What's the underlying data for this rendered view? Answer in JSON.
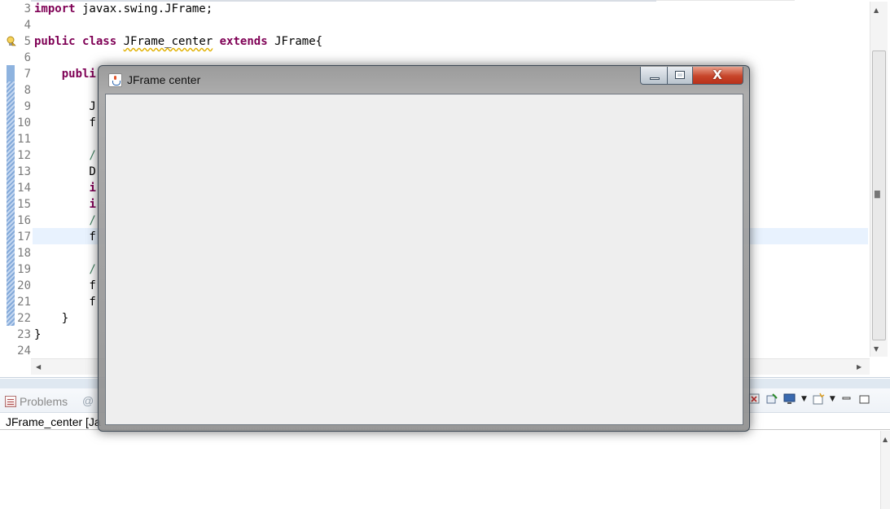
{
  "editor": {
    "lines": [
      {
        "num": "3",
        "segments": [
          {
            "t": "import",
            "c": "kw"
          },
          {
            "t": " javax.swing.JFrame;",
            "c": ""
          }
        ]
      },
      {
        "num": "4",
        "segments": []
      },
      {
        "num": "5",
        "segments": [
          {
            "t": "public",
            "c": "kw"
          },
          {
            "t": " ",
            "c": ""
          },
          {
            "t": "class",
            "c": "kw"
          },
          {
            "t": " ",
            "c": ""
          },
          {
            "t": "JFrame_center",
            "c": "squiggle"
          },
          {
            "t": " ",
            "c": ""
          },
          {
            "t": "extends",
            "c": "kw"
          },
          {
            "t": " JFrame{",
            "c": ""
          }
        ]
      },
      {
        "num": "6",
        "segments": []
      },
      {
        "num": "7",
        "segments": [
          {
            "t": "    ",
            "c": ""
          },
          {
            "t": "publi",
            "c": "kw"
          }
        ]
      },
      {
        "num": "8",
        "segments": []
      },
      {
        "num": "9",
        "segments": [
          {
            "t": "        J",
            "c": ""
          }
        ]
      },
      {
        "num": "10",
        "segments": [
          {
            "t": "        f",
            "c": ""
          }
        ]
      },
      {
        "num": "11",
        "segments": []
      },
      {
        "num": "12",
        "segments": [
          {
            "t": "        /",
            "c": "cmt"
          }
        ]
      },
      {
        "num": "13",
        "segments": [
          {
            "t": "        D",
            "c": ""
          }
        ]
      },
      {
        "num": "14",
        "segments": [
          {
            "t": "        ",
            "c": ""
          },
          {
            "t": "i",
            "c": "kw"
          }
        ]
      },
      {
        "num": "15",
        "segments": [
          {
            "t": "        ",
            "c": ""
          },
          {
            "t": "i",
            "c": "kw"
          }
        ]
      },
      {
        "num": "16",
        "segments": [
          {
            "t": "        /",
            "c": "cmt"
          }
        ]
      },
      {
        "num": "17",
        "segments": [
          {
            "t": "        f",
            "c": ""
          }
        ]
      },
      {
        "num": "18",
        "segments": []
      },
      {
        "num": "19",
        "segments": [
          {
            "t": "        /",
            "c": "cmt"
          }
        ]
      },
      {
        "num": "20",
        "segments": [
          {
            "t": "        f",
            "c": ""
          }
        ]
      },
      {
        "num": "21",
        "segments": [
          {
            "t": "        f",
            "c": ""
          }
        ]
      },
      {
        "num": "22",
        "segments": [
          {
            "t": "    }",
            "c": ""
          }
        ]
      },
      {
        "num": "23",
        "segments": [
          {
            "t": "}",
            "c": ""
          }
        ]
      },
      {
        "num": "24",
        "segments": []
      }
    ]
  },
  "panel": {
    "problems_tab": "Problems",
    "at_tab": "@",
    "console_label": "JFrame_center [Ja"
  },
  "jframe": {
    "title": "JFrame center",
    "close_glyph": "X"
  },
  "colors": {
    "keyword": "#7f0055",
    "comment": "#3f7f5f",
    "current_line": "#e8f2fe",
    "close_button": "#c7452a"
  }
}
